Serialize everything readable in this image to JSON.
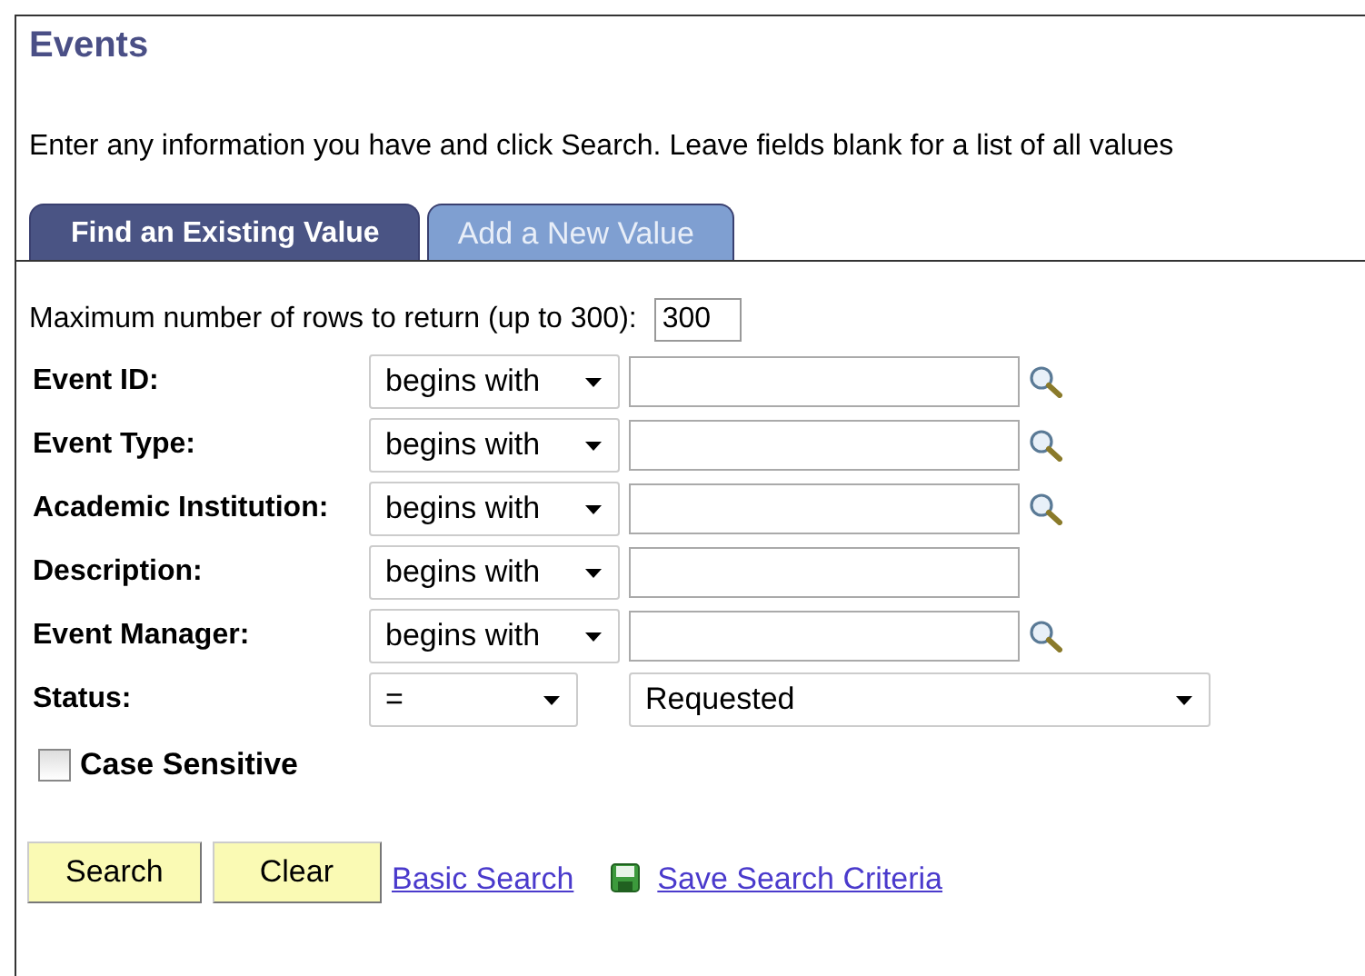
{
  "page_title": "Events",
  "instructions": "Enter any information you have and click Search. Leave fields blank for a list of all values",
  "tabs": [
    {
      "label": "Find an Existing Value",
      "selected": true
    },
    {
      "label": "Add a New Value",
      "selected": false
    }
  ],
  "max_rows": {
    "label": "Maximum number of rows to return (up to 300):",
    "value": "300"
  },
  "criteria": [
    {
      "label": "Event ID:",
      "operator": "begins with",
      "kind": "text",
      "lookup": true
    },
    {
      "label": "Event Type:",
      "operator": "begins with",
      "kind": "text",
      "lookup": true
    },
    {
      "label": "Academic Institution:",
      "operator": "begins with",
      "kind": "text",
      "lookup": true
    },
    {
      "label": "Description:",
      "operator": "begins with",
      "kind": "text",
      "lookup": false
    },
    {
      "label": "Event Manager:",
      "operator": "begins with",
      "kind": "text",
      "lookup": true
    },
    {
      "label": "Status:",
      "operator": "=",
      "kind": "dropdown",
      "value": "Requested"
    }
  ],
  "case_sensitive": {
    "label": "Case Sensitive",
    "checked": false
  },
  "buttons": [
    "Search",
    "Clear"
  ],
  "links": [
    {
      "label": "Basic Search",
      "kind": "plain"
    },
    {
      "label": "Save Search Criteria",
      "kind": "save"
    }
  ]
}
